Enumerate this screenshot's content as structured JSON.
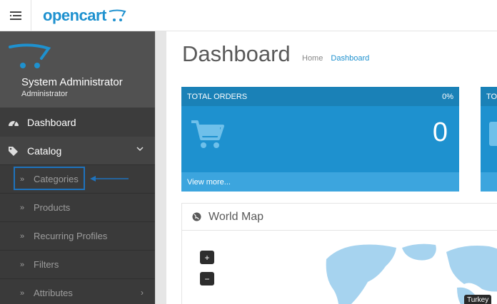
{
  "header": {
    "logo_text": "opencart",
    "menu_icon": "bars-icon"
  },
  "sidebar": {
    "profile": {
      "name": "System Administrator",
      "role": "Administrator"
    },
    "nav": [
      {
        "label": "Dashboard",
        "icon": "dashboard-icon"
      },
      {
        "label": "Catalog",
        "icon": "tags-icon"
      }
    ],
    "catalog_items": [
      {
        "label": "Categories"
      },
      {
        "label": "Products"
      },
      {
        "label": "Recurring Profiles"
      },
      {
        "label": "Filters"
      },
      {
        "label": "Attributes"
      }
    ],
    "colors": {
      "bg": "#515151",
      "active": "#3c3c3c",
      "highlight": "#1e73be"
    }
  },
  "main": {
    "title": "Dashboard",
    "breadcrumb": {
      "home": "Home",
      "current": "Dashboard"
    },
    "tiles": [
      {
        "title": "TOTAL ORDERS",
        "percent": "0%",
        "value": "0",
        "footer": "View more..."
      },
      {
        "title": "TO"
      }
    ],
    "world_map": {
      "title": "World Map",
      "zoom_in": "+",
      "zoom_out": "−",
      "tooltip": "Turkey"
    },
    "colors": {
      "accent": "#1e91cf"
    }
  }
}
